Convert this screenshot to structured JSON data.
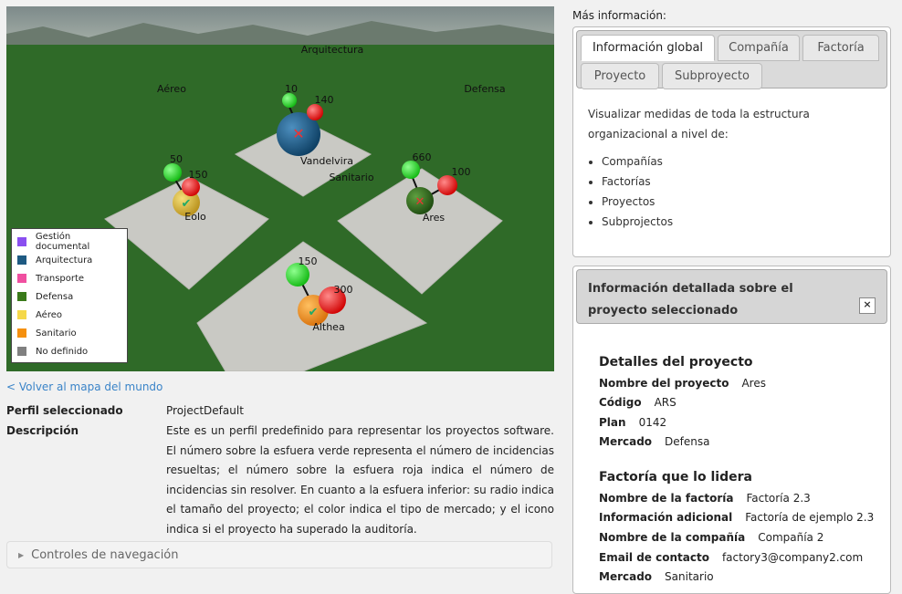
{
  "scene": {
    "sectors": {
      "top": "Arquitectura",
      "left": "Aéreo",
      "right": "Defensa",
      "center": "Sanitario"
    },
    "projects": [
      {
        "name": "Vandelvira",
        "green": "10",
        "red": "140",
        "color": "#1e5a82",
        "icon": "cross-icon"
      },
      {
        "name": "Eolo",
        "green": "50",
        "red": "150",
        "color": "#d6b43a",
        "icon": "check-icon"
      },
      {
        "name": "Ares",
        "green": "660",
        "red": "100",
        "color": "#2e6e1a",
        "icon": "cross-icon"
      },
      {
        "name": "Althea",
        "green": "150",
        "red": "300",
        "color": "#f0901e",
        "icon": "check-icon"
      }
    ],
    "legend": [
      {
        "label": "Gestión documental",
        "color": "#8a4ff0"
      },
      {
        "label": "Arquitectura",
        "color": "#1e5a82"
      },
      {
        "label": "Transporte",
        "color": "#f04fa0"
      },
      {
        "label": "Defensa",
        "color": "#3a7a1a"
      },
      {
        "label": "Aéreo",
        "color": "#f5d84a"
      },
      {
        "label": "Sanitario",
        "color": "#f5900f"
      },
      {
        "label": "No definido",
        "color": "#808080"
      }
    ]
  },
  "left": {
    "back_link": "< Volver al mapa del mundo",
    "profile_label": "Perfil seleccionado",
    "profile_value": "ProjectDefault",
    "desc_label": "Descripción",
    "desc_value": "Este es un perfil predefinido para representar los proyectos software. El número sobre la esfuera verde representa el número de incidencias resueltas; el número sobre la esfuera roja indica el número de incidencias sin resolver. En cuanto a la esfuera inferior: su radio indica el tamaño del proyecto; el color indica el tipo de mercado; y el icono indica si el proyecto ha superado la auditoría.",
    "nav_controls": "Controles de navegación"
  },
  "right": {
    "title": "Más información:",
    "tabs": [
      "Información global",
      "Compañía",
      "Factoría",
      "Proyecto",
      "Subproyecto"
    ],
    "global_text": "Visualizar medidas de toda la estructura organizacional a nivel de:",
    "global_items": [
      "Compañías",
      "Factorías",
      "Proyectos",
      "Subprojectos"
    ],
    "detail_title": "Información detallada sobre el proyecto seleccionado",
    "close": "×",
    "project_heading": "Detalles del proyecto",
    "project_fields": [
      {
        "k": "Nombre del proyecto",
        "v": "Ares"
      },
      {
        "k": "Código",
        "v": "ARS"
      },
      {
        "k": "Plan",
        "v": "0142"
      },
      {
        "k": "Mercado",
        "v": "Defensa"
      }
    ],
    "factory_heading": "Factoría que lo lidera",
    "factory_fields": [
      {
        "k": "Nombre de la factoría",
        "v": "Factoría 2.3"
      },
      {
        "k": "Información adicional",
        "v": "Factoría de ejemplo 2.3"
      },
      {
        "k": "Nombre de la compañía",
        "v": "Compañía 2"
      },
      {
        "k": "Email de contacto",
        "v": "factory3@company2.com"
      },
      {
        "k": "Mercado",
        "v": "Sanitario"
      }
    ]
  }
}
